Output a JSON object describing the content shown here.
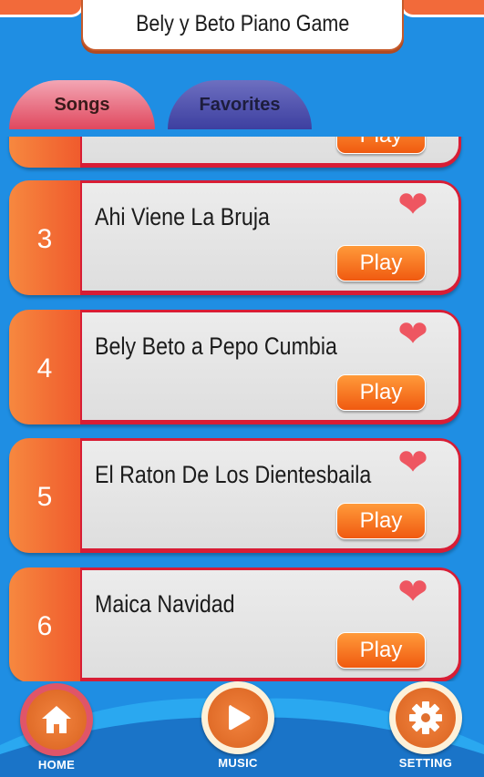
{
  "app": {
    "title": "Bely y Beto Piano Game"
  },
  "tabs": [
    {
      "label": "Songs",
      "active": true
    },
    {
      "label": "Favorites",
      "active": false
    }
  ],
  "songs": [
    {
      "number": "",
      "title": "",
      "play": "Play"
    },
    {
      "number": "3",
      "title": "Ahi Viene La Bruja",
      "play": "Play"
    },
    {
      "number": "4",
      "title": "Bely Beto a Pepo Cumbia",
      "play": "Play"
    },
    {
      "number": "5",
      "title": "El Raton De Los Dientesbaila",
      "play": "Play"
    },
    {
      "number": "6",
      "title": "Maica Navidad",
      "play": "Play"
    }
  ],
  "nav": {
    "home": "HOME",
    "music": "MUSIC",
    "setting": "SETTING"
  },
  "colors": {
    "background": "#1f8ee3",
    "accent": "#f05b2d",
    "card_border": "#d81d35",
    "heart": "#ee5661"
  }
}
